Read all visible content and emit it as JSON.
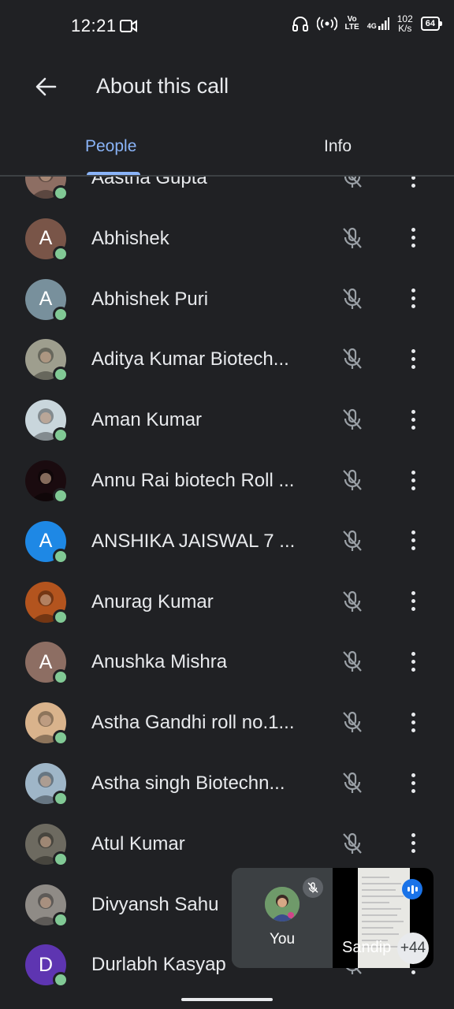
{
  "status": {
    "time": "12:21",
    "net_type_top": "Vo",
    "net_type_bottom": "LTE",
    "net_gen": "4G",
    "speed_value": "102",
    "speed_unit": "K/s",
    "battery": "64"
  },
  "header": {
    "title": "About this call"
  },
  "tabs": [
    {
      "label": "People"
    },
    {
      "label": "Info"
    }
  ],
  "participants": [
    {
      "name": "Aastha Gupta",
      "initial": "",
      "avatar_color": "#8d6e63",
      "photo": true
    },
    {
      "name": "Abhishek",
      "initial": "A",
      "avatar_color": "#795548",
      "photo": false
    },
    {
      "name": "Abhishek Puri",
      "initial": "A",
      "avatar_color": "#78909c",
      "photo": false
    },
    {
      "name": "Aditya Kumar Biotech...",
      "initial": "",
      "avatar_color": "#9e9e8e",
      "photo": true
    },
    {
      "name": "Aman Kumar",
      "initial": "",
      "avatar_color": "#c9d6dc",
      "photo": true
    },
    {
      "name": "Annu Rai biotech Roll ...",
      "initial": "",
      "avatar_color": "#1a0b0f",
      "photo": true
    },
    {
      "name": "ANSHIKA JAISWAL 7 ...",
      "initial": "A",
      "avatar_color": "#1e88e5",
      "photo": false
    },
    {
      "name": "Anurag Kumar",
      "initial": "",
      "avatar_color": "#b3541e",
      "photo": true
    },
    {
      "name": "Anushka Mishra",
      "initial": "A",
      "avatar_color": "#8d6e63",
      "photo": false
    },
    {
      "name": "Astha Gandhi roll no.1...",
      "initial": "",
      "avatar_color": "#d9b38c",
      "photo": true
    },
    {
      "name": "Astha singh Biotechn...",
      "initial": "",
      "avatar_color": "#9fb6c8",
      "photo": true
    },
    {
      "name": "Atul Kumar",
      "initial": "",
      "avatar_color": "#6d6a60",
      "photo": true
    },
    {
      "name": "Divyansh Sahu",
      "initial": "",
      "avatar_color": "#8f8b86",
      "photo": true
    },
    {
      "name": "Durlabh Kasyap",
      "initial": "D",
      "avatar_color": "#5e35b1",
      "photo": false
    }
  ],
  "pip": {
    "self_label": "You",
    "other_label": "Sandip",
    "more_count": "+44"
  }
}
